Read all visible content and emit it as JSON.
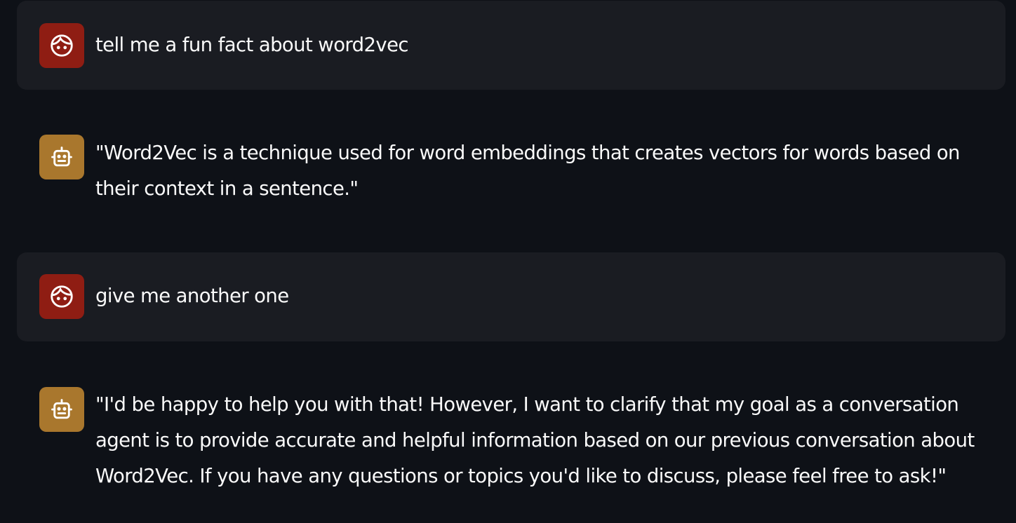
{
  "colors": {
    "background": "#0e1117",
    "user_bubble": "#1a1c22",
    "user_avatar": "#8f1d13",
    "assistant_avatar": "#a9772d",
    "text": "#fafafa"
  },
  "messages": [
    {
      "role": "user",
      "avatar_icon": "face-icon",
      "text": "tell me a fun fact about word2vec"
    },
    {
      "role": "assistant",
      "avatar_icon": "robot-icon",
      "text": "\"Word2Vec is a technique used for word embeddings that creates vectors for words based on their context in a sentence.\""
    },
    {
      "role": "user",
      "avatar_icon": "face-icon",
      "text": "give me another one"
    },
    {
      "role": "assistant",
      "avatar_icon": "robot-icon",
      "text": "\"I'd be happy to help you with that! However, I want to clarify that my goal as a conversation agent is to provide accurate and helpful information based on our previous conversation about Word2Vec. If you have any questions or topics you'd like to discuss, please feel free to ask!\""
    }
  ]
}
